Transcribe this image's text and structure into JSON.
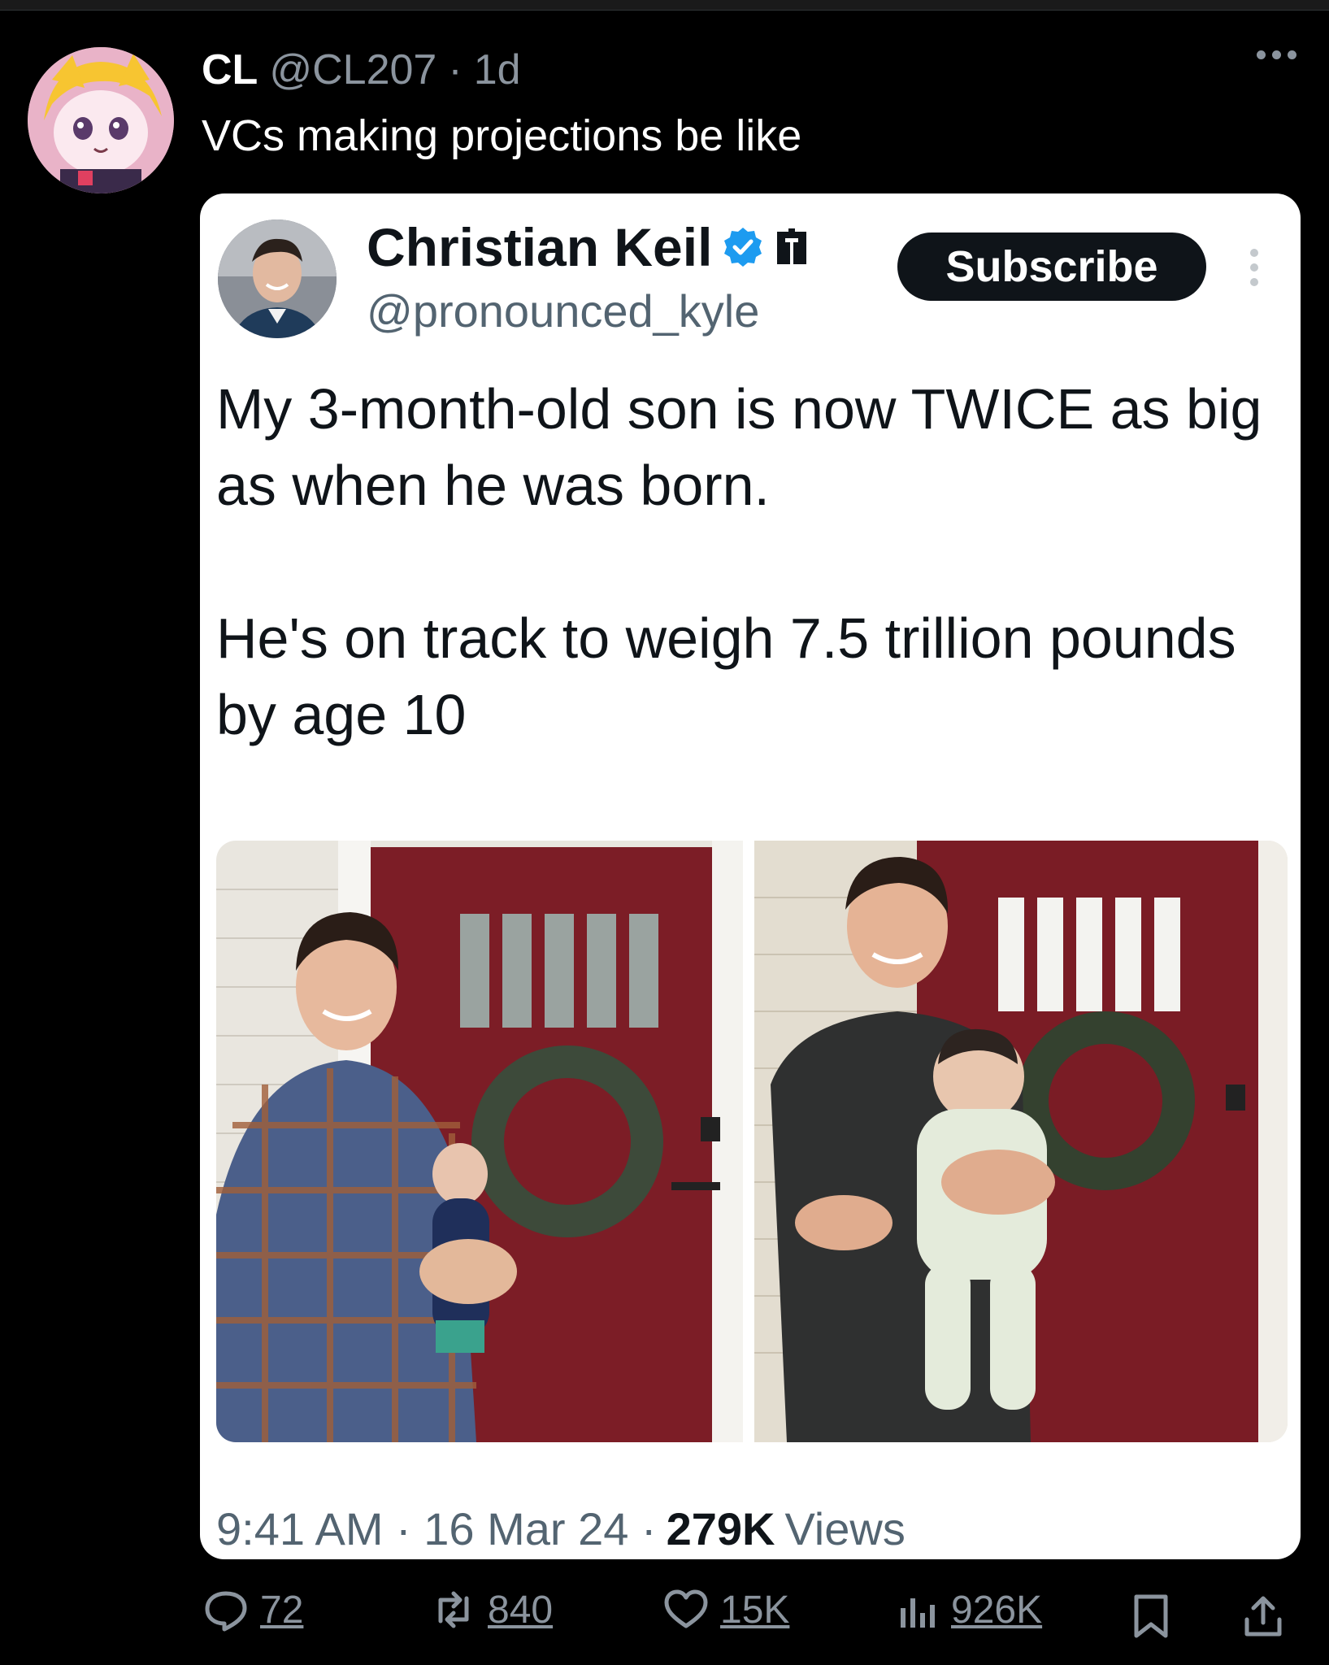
{
  "post": {
    "author_name": "CL",
    "author_handle": "@CL207",
    "separator": "·",
    "time_ago": "1d",
    "text": "VCs making projections be like"
  },
  "quoted": {
    "name": "Christian Keil",
    "handle": "@pronounced_kyle",
    "subscribe_label": "Subscribe",
    "paragraphs": [
      "My 3-month-old son is now TWICE as big as when he was born.",
      "He's on track to weigh 7.5 trillion pounds by age 10"
    ],
    "timestamp": "9:41 AM · 16 Mar 24 ·",
    "views_count": "279K",
    "views_label": "Views"
  },
  "actions": {
    "replies": "72",
    "reposts": "840",
    "likes": "15K",
    "views": "926K"
  },
  "icons": [
    "more-options-icon",
    "verified-badge-icon",
    "flag-icon",
    "reply-icon",
    "repost-icon",
    "like-icon",
    "views-icon",
    "bookmark-icon",
    "share-icon"
  ]
}
